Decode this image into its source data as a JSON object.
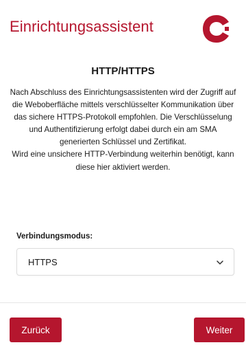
{
  "header": {
    "title": "Einrichtungsassistent",
    "logo_icon": "sma-logo-icon",
    "brand_color": "#b5162e"
  },
  "section": {
    "title": "HTTP/HTTPS",
    "description": [
      "Nach Abschluss des Einrichtungsassistenten wird der Zugriff auf die Weboberfläche mittels verschlüsselter Kommunikation über das sichere HTTPS-Protokoll empfohlen. Die Verschlüsselung und Authentifizierung erfolgt dabei durch ein am SMA generierten Schlüssel und Zertifikat.",
      "Wird eine unsichere HTTP-Verbindung weiterhin benötigt, kann diese hier aktiviert werden."
    ]
  },
  "form": {
    "connection_mode_label": "Verbindungsmodus:",
    "connection_mode_value": "HTTPS",
    "dropdown_icon": "chevron-down-icon"
  },
  "footer": {
    "back_label": "Zurück",
    "next_label": "Weiter"
  }
}
